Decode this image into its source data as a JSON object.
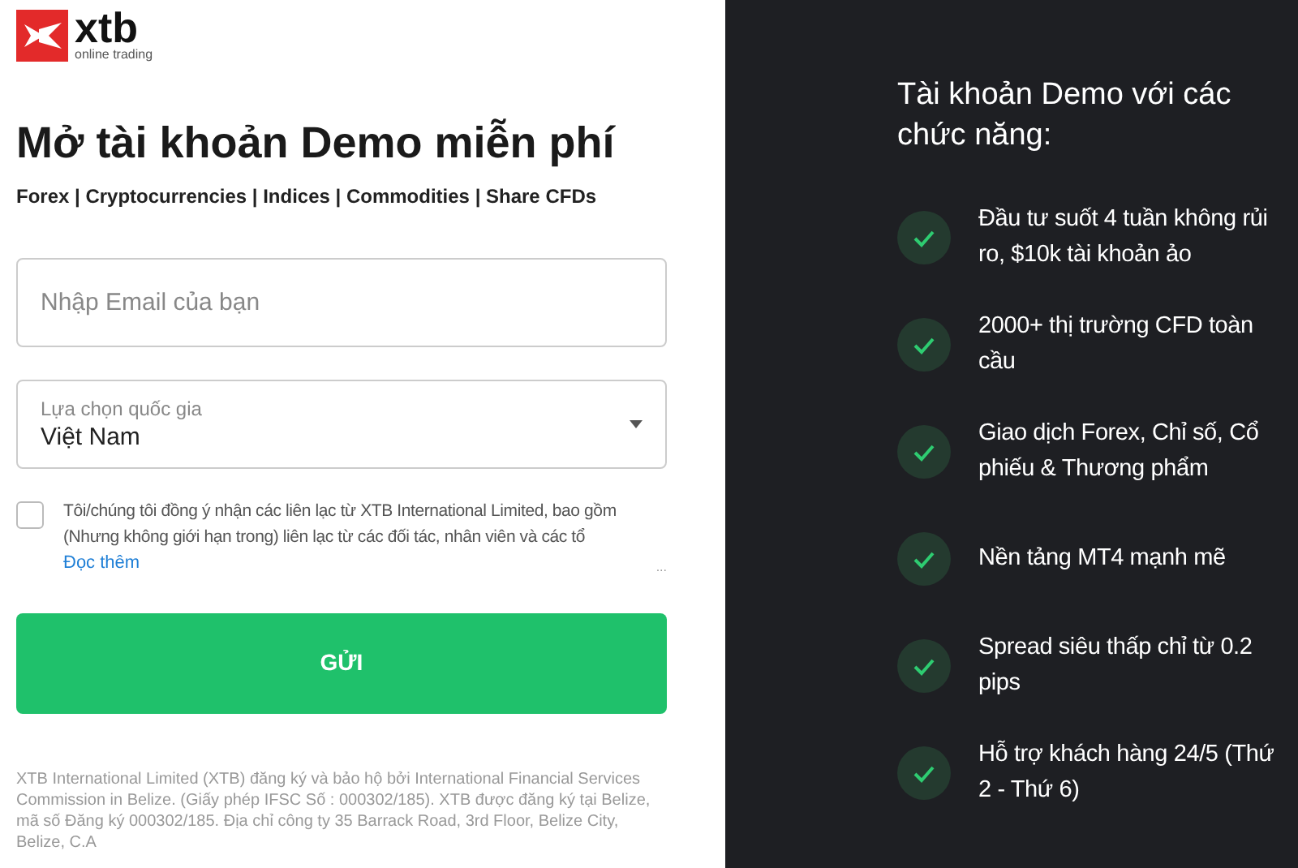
{
  "logo": {
    "mark": "xtb",
    "tagline": "online trading"
  },
  "heading": "Mở tài khoản Demo miễn phí",
  "markets": "Forex | Cryptocurrencies | Indices | Commodities | Share CFDs",
  "email_field": {
    "placeholder": "Nhập Email của bạn"
  },
  "country_select": {
    "label": "Lựa chọn quốc gia",
    "value": "Việt Nam"
  },
  "consent": {
    "checked": false,
    "text": "Tôi/chúng tôi đồng ý nhận các liên lạc từ XTB International Limited, bao gồm (Nhưng không giới hạn trong) liên lạc từ các đối tác, nhân viên và các tổ",
    "link": "Đọc thêm",
    "more": "..."
  },
  "submit_button": "GỬI",
  "footer": "XTB International Limited (XTB) đăng ký và bảo hộ bởi International Financial Services Commission in Belize. (Giấy phép IFSC Số : 000302/185). XTB được đăng ký tại Belize, mã số Đăng ký 000302/185. Địa chỉ công ty 35 Barrack Road, 3rd Floor, Belize City, Belize, C.A",
  "features": {
    "title": "Tài khoản Demo với các chức năng:",
    "items": [
      {
        "text": "Đầu tư suốt 4 tuần không rủi ro, $10k tài khoản ảo"
      },
      {
        "text": "2000+ thị trường CFD toàn cầu"
      },
      {
        "text": "Giao dịch Forex, Chỉ số, Cổ phiếu & Thương phẩm"
      },
      {
        "text": "Nền tảng MT4 mạnh mẽ"
      },
      {
        "text": "Spread siêu thấp chỉ từ 0.2 pips"
      },
      {
        "text": "Hỗ trợ khách hàng 24/5 (Thứ 2 - Thứ 6)"
      }
    ]
  }
}
